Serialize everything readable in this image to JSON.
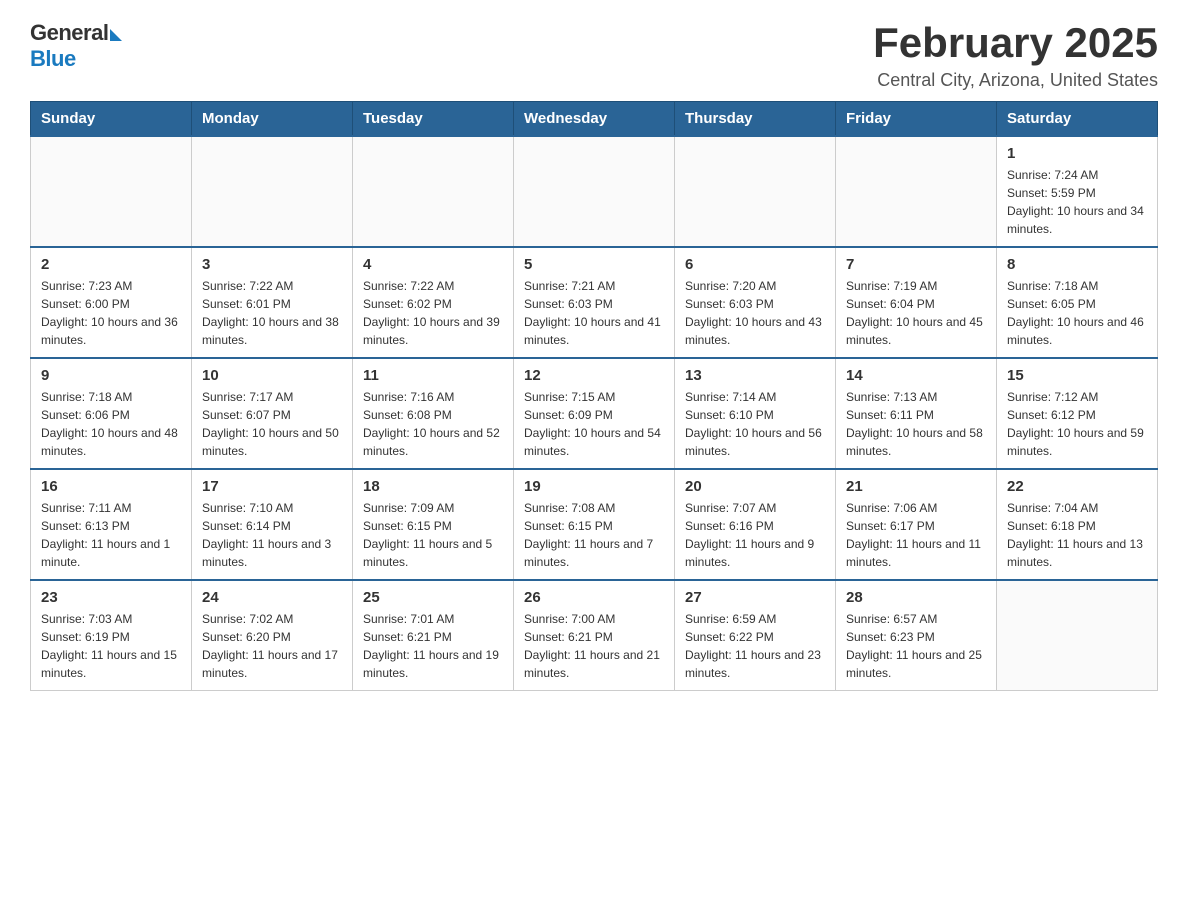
{
  "header": {
    "logo_general": "General",
    "logo_blue": "Blue",
    "title": "February 2025",
    "subtitle": "Central City, Arizona, United States"
  },
  "days_of_week": [
    "Sunday",
    "Monday",
    "Tuesday",
    "Wednesday",
    "Thursday",
    "Friday",
    "Saturday"
  ],
  "weeks": [
    [
      {
        "day": null
      },
      {
        "day": null
      },
      {
        "day": null
      },
      {
        "day": null
      },
      {
        "day": null
      },
      {
        "day": null
      },
      {
        "day": 1,
        "sunrise": "Sunrise: 7:24 AM",
        "sunset": "Sunset: 5:59 PM",
        "daylight": "Daylight: 10 hours and 34 minutes."
      }
    ],
    [
      {
        "day": 2,
        "sunrise": "Sunrise: 7:23 AM",
        "sunset": "Sunset: 6:00 PM",
        "daylight": "Daylight: 10 hours and 36 minutes."
      },
      {
        "day": 3,
        "sunrise": "Sunrise: 7:22 AM",
        "sunset": "Sunset: 6:01 PM",
        "daylight": "Daylight: 10 hours and 38 minutes."
      },
      {
        "day": 4,
        "sunrise": "Sunrise: 7:22 AM",
        "sunset": "Sunset: 6:02 PM",
        "daylight": "Daylight: 10 hours and 39 minutes."
      },
      {
        "day": 5,
        "sunrise": "Sunrise: 7:21 AM",
        "sunset": "Sunset: 6:03 PM",
        "daylight": "Daylight: 10 hours and 41 minutes."
      },
      {
        "day": 6,
        "sunrise": "Sunrise: 7:20 AM",
        "sunset": "Sunset: 6:03 PM",
        "daylight": "Daylight: 10 hours and 43 minutes."
      },
      {
        "day": 7,
        "sunrise": "Sunrise: 7:19 AM",
        "sunset": "Sunset: 6:04 PM",
        "daylight": "Daylight: 10 hours and 45 minutes."
      },
      {
        "day": 8,
        "sunrise": "Sunrise: 7:18 AM",
        "sunset": "Sunset: 6:05 PM",
        "daylight": "Daylight: 10 hours and 46 minutes."
      }
    ],
    [
      {
        "day": 9,
        "sunrise": "Sunrise: 7:18 AM",
        "sunset": "Sunset: 6:06 PM",
        "daylight": "Daylight: 10 hours and 48 minutes."
      },
      {
        "day": 10,
        "sunrise": "Sunrise: 7:17 AM",
        "sunset": "Sunset: 6:07 PM",
        "daylight": "Daylight: 10 hours and 50 minutes."
      },
      {
        "day": 11,
        "sunrise": "Sunrise: 7:16 AM",
        "sunset": "Sunset: 6:08 PM",
        "daylight": "Daylight: 10 hours and 52 minutes."
      },
      {
        "day": 12,
        "sunrise": "Sunrise: 7:15 AM",
        "sunset": "Sunset: 6:09 PM",
        "daylight": "Daylight: 10 hours and 54 minutes."
      },
      {
        "day": 13,
        "sunrise": "Sunrise: 7:14 AM",
        "sunset": "Sunset: 6:10 PM",
        "daylight": "Daylight: 10 hours and 56 minutes."
      },
      {
        "day": 14,
        "sunrise": "Sunrise: 7:13 AM",
        "sunset": "Sunset: 6:11 PM",
        "daylight": "Daylight: 10 hours and 58 minutes."
      },
      {
        "day": 15,
        "sunrise": "Sunrise: 7:12 AM",
        "sunset": "Sunset: 6:12 PM",
        "daylight": "Daylight: 10 hours and 59 minutes."
      }
    ],
    [
      {
        "day": 16,
        "sunrise": "Sunrise: 7:11 AM",
        "sunset": "Sunset: 6:13 PM",
        "daylight": "Daylight: 11 hours and 1 minute."
      },
      {
        "day": 17,
        "sunrise": "Sunrise: 7:10 AM",
        "sunset": "Sunset: 6:14 PM",
        "daylight": "Daylight: 11 hours and 3 minutes."
      },
      {
        "day": 18,
        "sunrise": "Sunrise: 7:09 AM",
        "sunset": "Sunset: 6:15 PM",
        "daylight": "Daylight: 11 hours and 5 minutes."
      },
      {
        "day": 19,
        "sunrise": "Sunrise: 7:08 AM",
        "sunset": "Sunset: 6:15 PM",
        "daylight": "Daylight: 11 hours and 7 minutes."
      },
      {
        "day": 20,
        "sunrise": "Sunrise: 7:07 AM",
        "sunset": "Sunset: 6:16 PM",
        "daylight": "Daylight: 11 hours and 9 minutes."
      },
      {
        "day": 21,
        "sunrise": "Sunrise: 7:06 AM",
        "sunset": "Sunset: 6:17 PM",
        "daylight": "Daylight: 11 hours and 11 minutes."
      },
      {
        "day": 22,
        "sunrise": "Sunrise: 7:04 AM",
        "sunset": "Sunset: 6:18 PM",
        "daylight": "Daylight: 11 hours and 13 minutes."
      }
    ],
    [
      {
        "day": 23,
        "sunrise": "Sunrise: 7:03 AM",
        "sunset": "Sunset: 6:19 PM",
        "daylight": "Daylight: 11 hours and 15 minutes."
      },
      {
        "day": 24,
        "sunrise": "Sunrise: 7:02 AM",
        "sunset": "Sunset: 6:20 PM",
        "daylight": "Daylight: 11 hours and 17 minutes."
      },
      {
        "day": 25,
        "sunrise": "Sunrise: 7:01 AM",
        "sunset": "Sunset: 6:21 PM",
        "daylight": "Daylight: 11 hours and 19 minutes."
      },
      {
        "day": 26,
        "sunrise": "Sunrise: 7:00 AM",
        "sunset": "Sunset: 6:21 PM",
        "daylight": "Daylight: 11 hours and 21 minutes."
      },
      {
        "day": 27,
        "sunrise": "Sunrise: 6:59 AM",
        "sunset": "Sunset: 6:22 PM",
        "daylight": "Daylight: 11 hours and 23 minutes."
      },
      {
        "day": 28,
        "sunrise": "Sunrise: 6:57 AM",
        "sunset": "Sunset: 6:23 PM",
        "daylight": "Daylight: 11 hours and 25 minutes."
      },
      {
        "day": null
      }
    ]
  ]
}
